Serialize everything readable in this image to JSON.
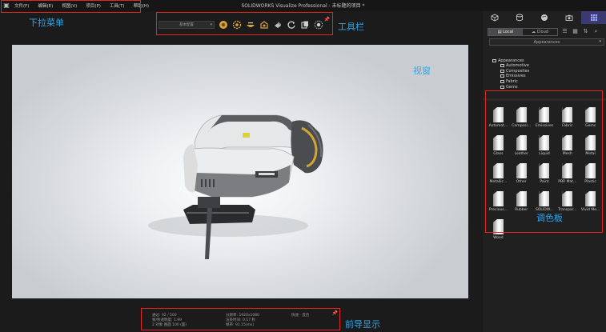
{
  "window": {
    "title": "SOLIDWORKS Visualize Professional - 未标题的项目 *",
    "menu": [
      "文件(F)",
      "编辑(E)",
      "视图(V)",
      "项目(P)",
      "工具(T)",
      "帮助(H)"
    ]
  },
  "toolbar": {
    "config_select": "基本配置",
    "icons": [
      "appearance-tool-icon",
      "gear-settings-icon",
      "bowl-scene-icon",
      "render-mode-icon",
      "sphere-icon",
      "refresh-icon",
      "camera-copy-icon",
      "sun-burst-icon"
    ]
  },
  "annotations": {
    "menu": "下拉菜单",
    "toolbar": "工具栏",
    "viewport": "视窗",
    "palette": "调色板",
    "stats": "前导显示"
  },
  "stats": {
    "passes": "通过: 92 / 500",
    "elapsed": "帧/秒透明度: 1.99",
    "model": "2 对象 图面 100 (面)",
    "resolution": "分辨率: 1920x1080",
    "preview": "渲染时间: 0:17 秒",
    "fps": "帧率: 91.15(ms)",
    "mode": "快速 · 混合"
  },
  "rpanel": {
    "tabs": [
      "model-tab",
      "library-tab",
      "appearance-tab",
      "camera-tab",
      "palette-tab"
    ],
    "source": {
      "local": "Local",
      "cloud": "Cloud"
    },
    "category_select": "Appearances",
    "tree": {
      "root": "Appearances",
      "children": [
        "Automotive",
        "Composites",
        "Emissives",
        "Fabric",
        "Gems"
      ]
    },
    "palette": [
      "Automot...",
      "Composi...",
      "Emissives",
      "Fabric",
      "Gems",
      "Glass",
      "Leather",
      "Liquid",
      "Mesh",
      "Metal",
      "Metallic...",
      "Other",
      "Paint",
      "PBR Mat...",
      "Plastic",
      "Precious...",
      "Rubber",
      "SOLIDW...",
      "Transpar...",
      "Vivid Me...",
      "Wood"
    ]
  }
}
